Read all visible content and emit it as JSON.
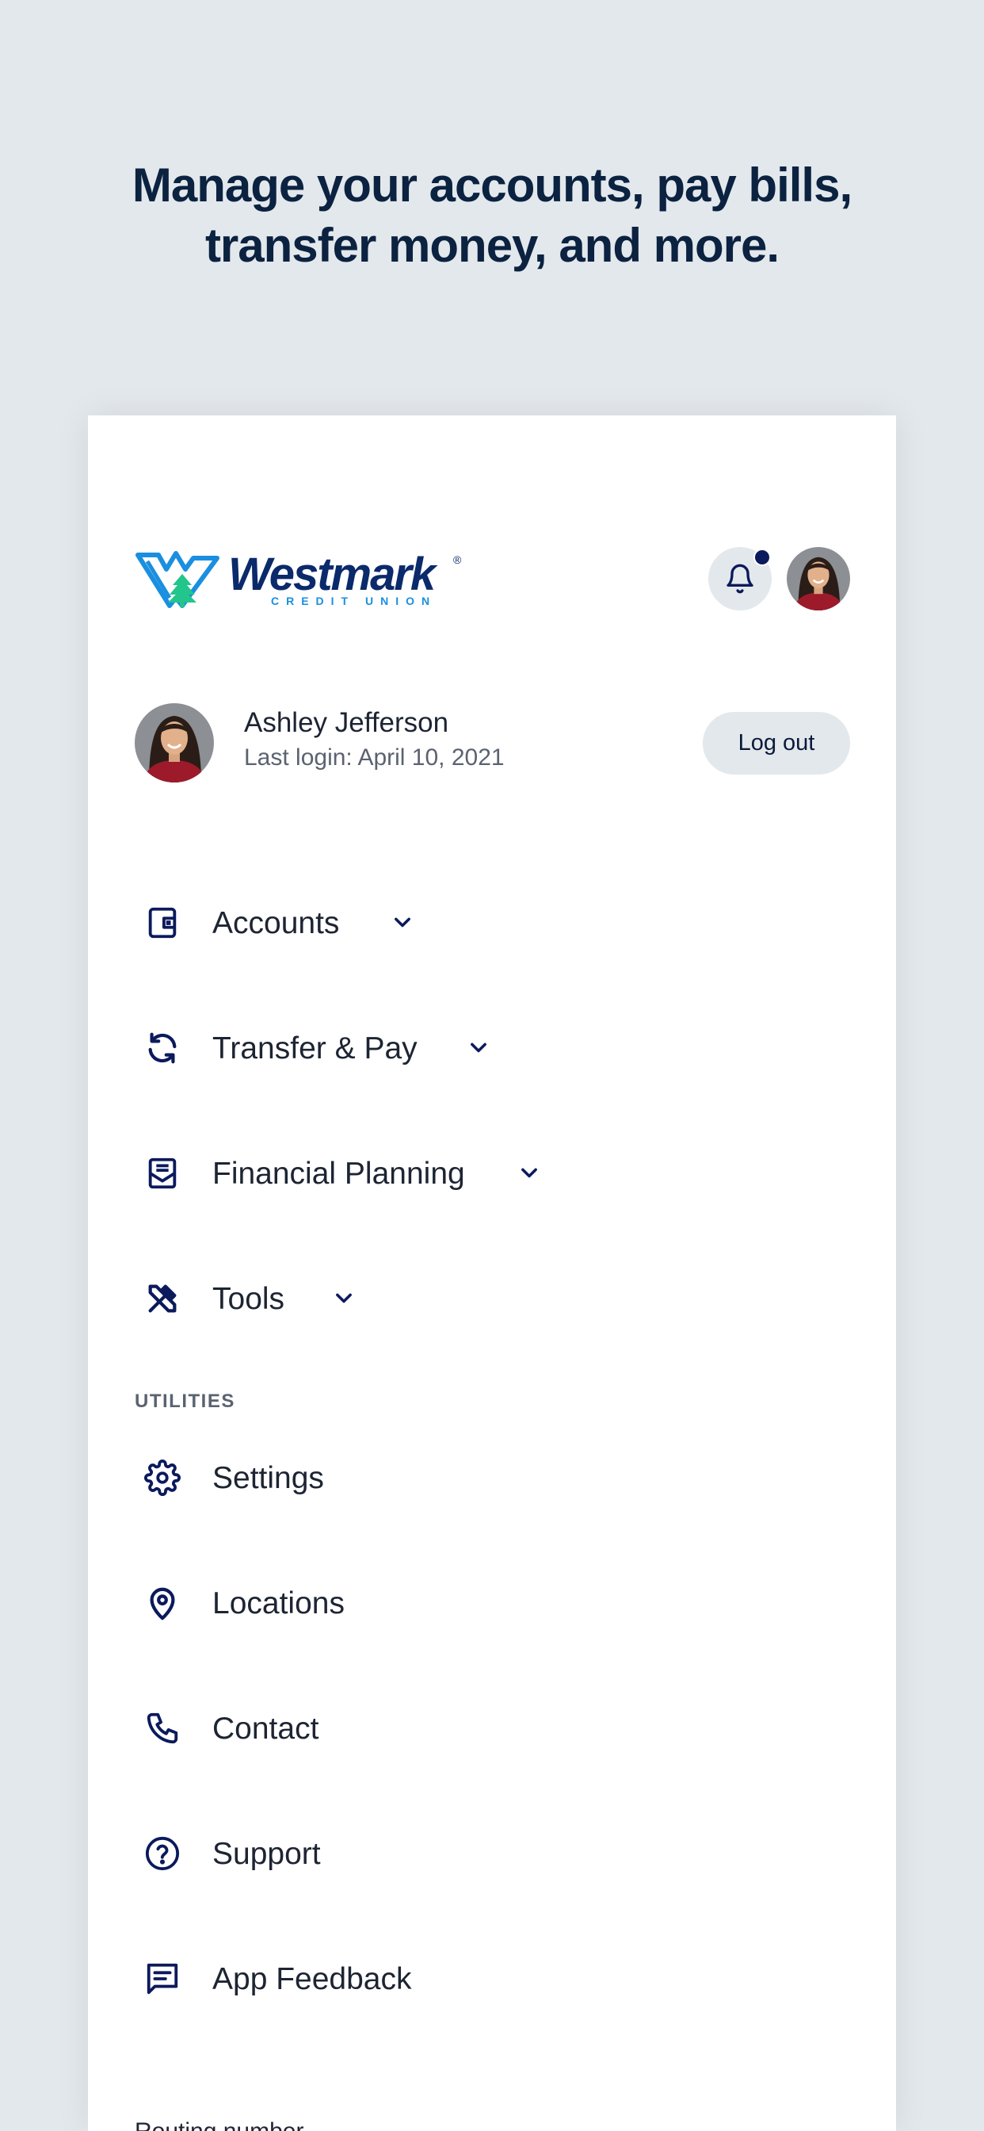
{
  "headline": {
    "line1": "Manage your accounts, pay bills,",
    "line2": "transfer money, and more."
  },
  "brand": {
    "name": "Westmark",
    "registered": "®",
    "subtitle": "CREDIT UNION",
    "primary_color": "#0b2a6b",
    "accent_color": "#1a8fe0",
    "tree_color": "#22c58b"
  },
  "header": {
    "notification_icon": "bell-icon",
    "has_unread": true
  },
  "user": {
    "name": "Ashley Jefferson",
    "last_login": "Last login: April 10, 2021",
    "logout_label": "Log out"
  },
  "nav": {
    "items": [
      {
        "label": "Accounts",
        "icon": "wallet-icon",
        "expandable": true
      },
      {
        "label": "Transfer & Pay",
        "icon": "refresh-icon",
        "expandable": true
      },
      {
        "label": "Financial Planning",
        "icon": "envelope-icon",
        "expandable": true
      },
      {
        "label": "Tools",
        "icon": "tools-icon",
        "expandable": true
      }
    ]
  },
  "utilities": {
    "section_label": "UTILITIES",
    "items": [
      {
        "label": "Settings",
        "icon": "gear-icon"
      },
      {
        "label": "Locations",
        "icon": "map-pin-icon"
      },
      {
        "label": "Contact",
        "icon": "phone-icon"
      },
      {
        "label": "Support",
        "icon": "help-circle-icon"
      },
      {
        "label": "App Feedback",
        "icon": "feedback-icon"
      }
    ]
  },
  "footer": {
    "routing_label": "Routing number"
  },
  "colors": {
    "background": "#e3e8ec",
    "navy": "#0b1a3c",
    "icon": "#0b1a5c"
  }
}
